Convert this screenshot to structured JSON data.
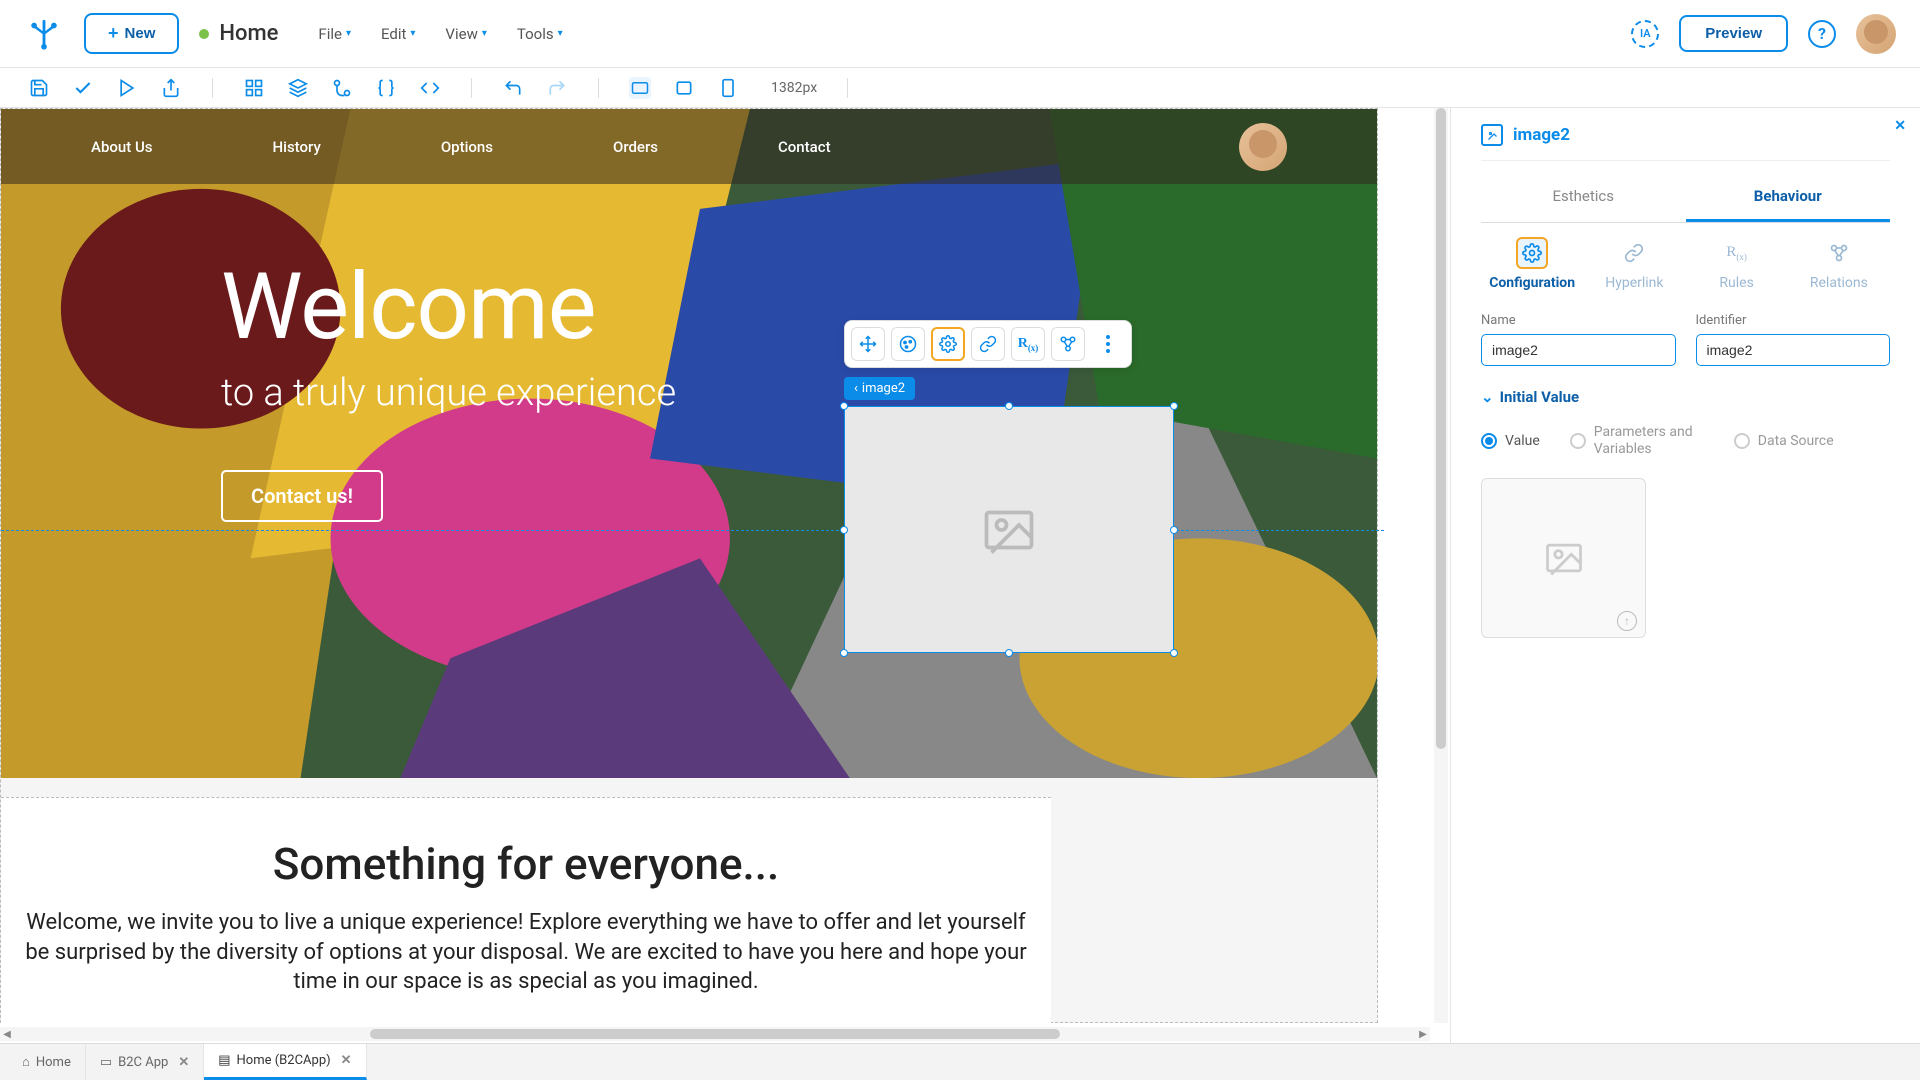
{
  "topbar": {
    "new_label": "New",
    "breadcrumb_title": "Home",
    "menus": {
      "file": "File",
      "edit": "Edit",
      "view": "View",
      "tools": "Tools"
    },
    "preview_label": "Preview"
  },
  "toolbar2": {
    "viewport": "1382px"
  },
  "hero": {
    "nav": {
      "about": "About Us",
      "history": "History",
      "options": "Options",
      "orders": "Orders",
      "contact": "Contact"
    },
    "title": "Welcome",
    "subtitle": "to a truly unique experience",
    "cta": "Contact us!"
  },
  "content": {
    "title": "Something for everyone...",
    "body": "Welcome, we invite you to live a unique experience! Explore everything we have to offer and let yourself be surprised by the diversity of options at your disposal. We are excited to have you here and hope your time in our space is as special as you imagined."
  },
  "selection": {
    "label": "image2"
  },
  "rightpanel": {
    "title": "image2",
    "tabs": {
      "esthetics": "Esthetics",
      "behaviour": "Behaviour"
    },
    "subtabs": {
      "configuration": "Configuration",
      "hyperlink": "Hyperlink",
      "rules": "Rules",
      "relations": "Relations"
    },
    "fields": {
      "name_label": "Name",
      "name_value": "image2",
      "identifier_label": "Identifier",
      "identifier_value": "image2"
    },
    "initial_value_label": "Initial Value",
    "radios": {
      "value": "Value",
      "params": "Parameters and Variables",
      "datasource": "Data Source"
    }
  },
  "bottomtabs": {
    "home": "Home",
    "b2c": "B2C App",
    "home_app": "Home (B2CApp)"
  }
}
